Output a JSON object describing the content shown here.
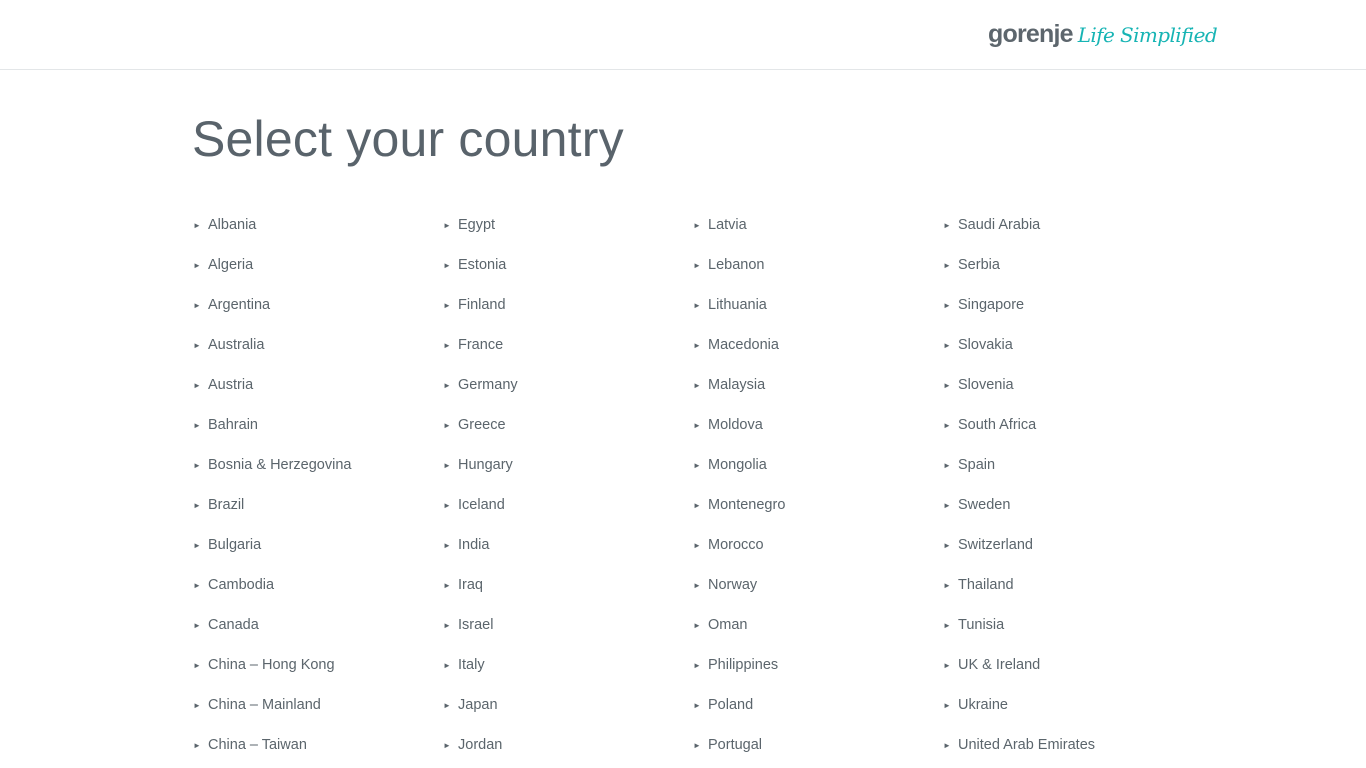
{
  "header": {
    "brand": "gorenje",
    "tagline": "Life Simplified"
  },
  "page_title": "Select your country",
  "arrow_glyph": "►",
  "columns": [
    [
      "Albania",
      "Algeria",
      "Argentina",
      "Australia",
      "Austria",
      "Bahrain",
      "Bosnia & Herzegovina",
      "Brazil",
      "Bulgaria",
      "Cambodia",
      "Canada",
      "China – Hong Kong",
      "China – Mainland",
      "China – Taiwan"
    ],
    [
      "Egypt",
      "Estonia",
      "Finland",
      "France",
      "Germany",
      "Greece",
      "Hungary",
      "Iceland",
      "India",
      "Iraq",
      "Israel",
      "Italy",
      "Japan",
      "Jordan"
    ],
    [
      "Latvia",
      "Lebanon",
      "Lithuania",
      "Macedonia",
      "Malaysia",
      "Moldova",
      "Mongolia",
      "Montenegro",
      "Morocco",
      "Norway",
      "Oman",
      "Philippines",
      "Poland",
      "Portugal"
    ],
    [
      "Saudi Arabia",
      "Serbia",
      "Singapore",
      "Slovakia",
      "Slovenia",
      "South Africa",
      "Spain",
      "Sweden",
      "Switzerland",
      "Thailand",
      "Tunisia",
      "UK & Ireland",
      "Ukraine",
      "United Arab Emirates"
    ]
  ]
}
